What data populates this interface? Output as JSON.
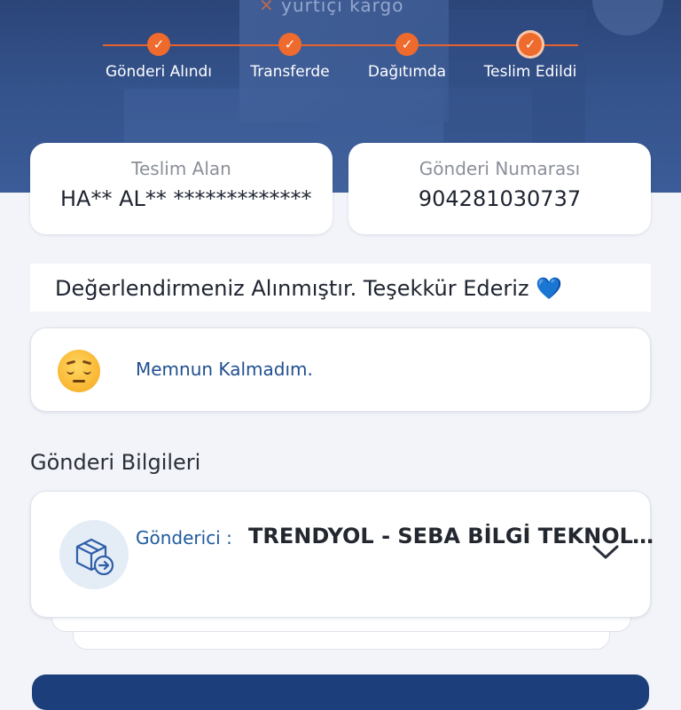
{
  "hero": {
    "logo_text": "yurtiçi kargo"
  },
  "progress": {
    "steps": [
      {
        "label": "Gönderi Alındı",
        "check": "✓"
      },
      {
        "label": "Transferde",
        "check": "✓"
      },
      {
        "label": "Dağıtımda",
        "check": "✓"
      },
      {
        "label": "Teslim Edildi",
        "check": "✓"
      }
    ],
    "current_step": 4,
    "accent_color": "#ef6a2d"
  },
  "recipient": {
    "label": "Teslim Alan",
    "value": "HA** AL** *************"
  },
  "shipment_number": {
    "label": "Gönderi Numarası",
    "value": "904281030737"
  },
  "feedback": {
    "thanks_message": "Değerlendirmeniz Alınmıştır. Teşekkür Ederiz",
    "heart_glyph": "💙",
    "rating_text": "Memnun Kalmadım.",
    "rating_icon": "pensive-face-emoji-icon"
  },
  "shipment_info": {
    "section_title": "Gönderi Bilgileri",
    "sender_label": "Gönderici :",
    "sender_value": "TRENDYOL - SEBA BİLGİ TEKNOLOJİLERİ",
    "icon": "package-transfer-icon",
    "expand_icon": "chevron-down-icon"
  },
  "colors": {
    "header_bg": "#34528b",
    "link_blue": "#1f5aa0",
    "bottom_button": "#1c3f7c"
  }
}
